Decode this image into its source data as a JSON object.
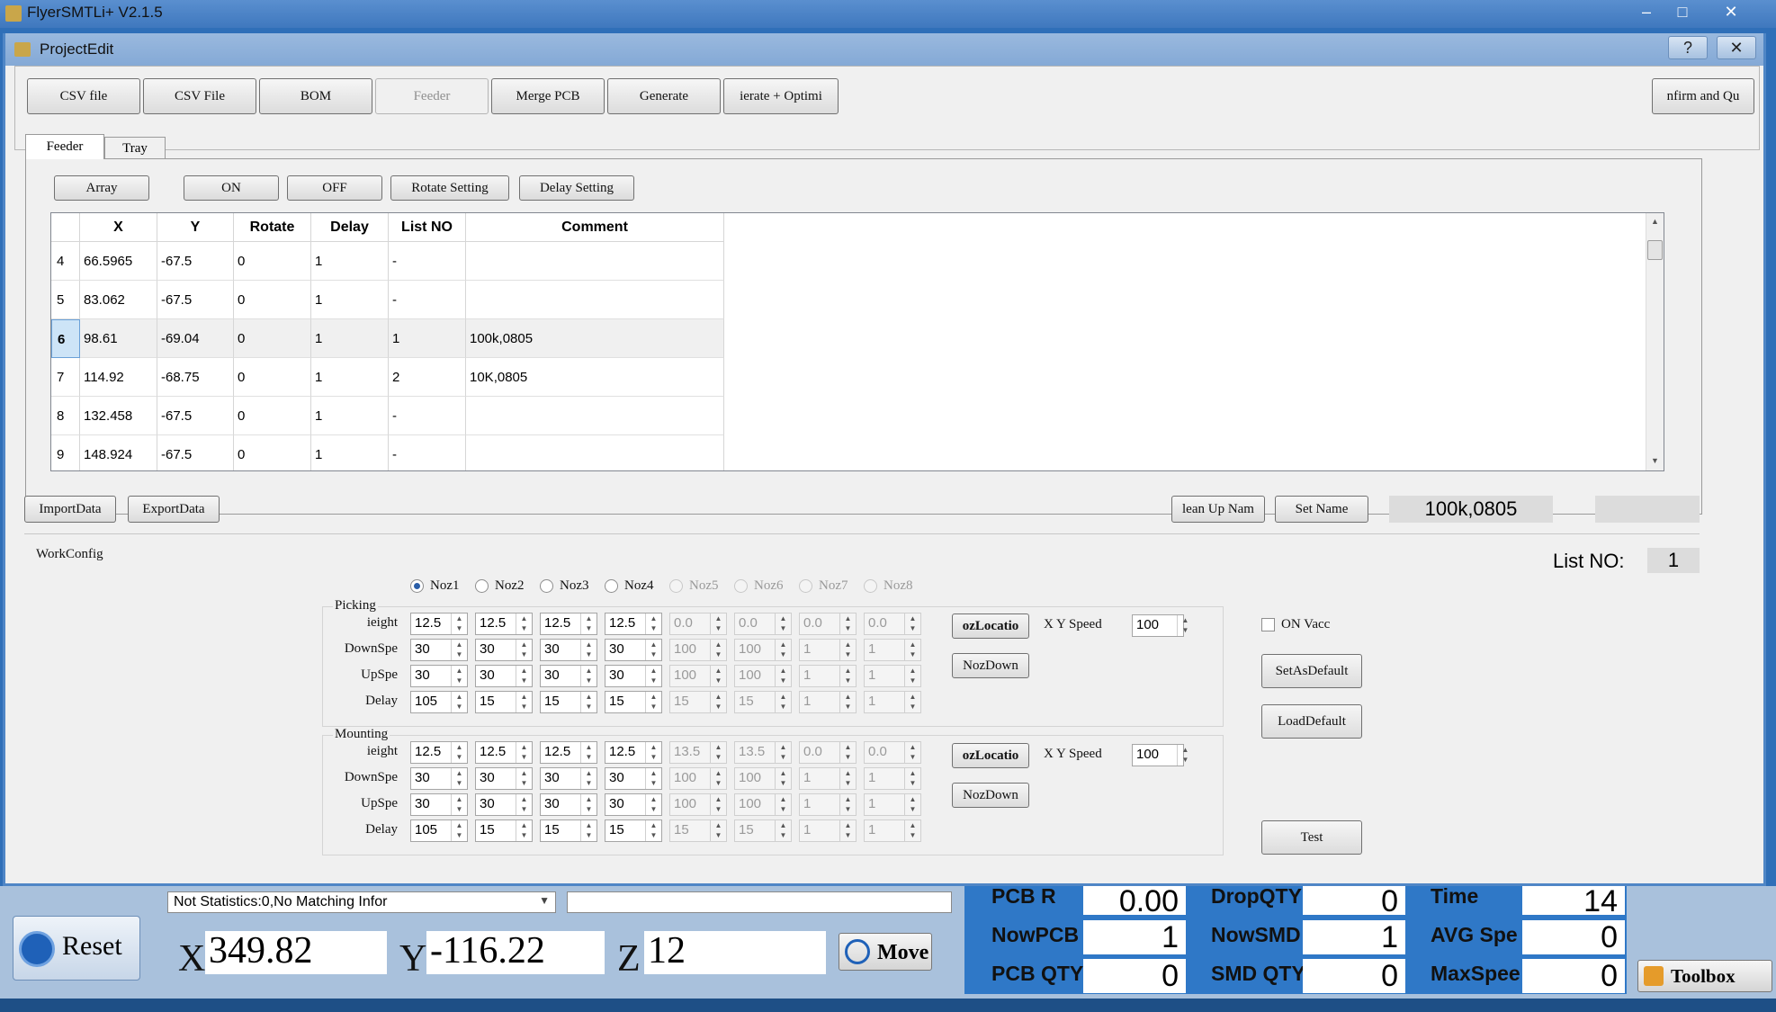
{
  "main_window": {
    "title": "FlyerSMTLi+ V2.1.5"
  },
  "dialog": {
    "title": "ProjectEdit",
    "help": "?",
    "close": "✕"
  },
  "toolbar": [
    {
      "label": "CSV file"
    },
    {
      "label": "CSV File"
    },
    {
      "label": "BOM"
    },
    {
      "label": "Feeder"
    },
    {
      "label": "Merge PCB"
    },
    {
      "label": "Generate"
    },
    {
      "label": "ierate + Optimi"
    }
  ],
  "confirm_button": "nfirm and Qu",
  "tabs": [
    "Feeder",
    "Tray"
  ],
  "feeder_buttons": {
    "array": "Array",
    "on": "ON",
    "off": "OFF",
    "rotate": "Rotate Setting",
    "delay": "Delay Setting"
  },
  "grid": {
    "columns": [
      "X",
      "Y",
      "Rotate",
      "Delay",
      "List NO",
      "Comment"
    ],
    "rows": [
      {
        "n": "4",
        "x": "66.5965",
        "y": "-67.5",
        "rotate": "0",
        "delay": "1",
        "list_no": "-",
        "comment": ""
      },
      {
        "n": "5",
        "x": "83.062",
        "y": "-67.5",
        "rotate": "0",
        "delay": "1",
        "list_no": "-",
        "comment": ""
      },
      {
        "n": "6",
        "x": "98.61",
        "y": "-69.04",
        "rotate": "0",
        "delay": "1",
        "list_no": "1",
        "comment": "100k,0805"
      },
      {
        "n": "7",
        "x": "114.92",
        "y": "-68.75",
        "rotate": "0",
        "delay": "1",
        "list_no": "2",
        "comment": "10K,0805"
      },
      {
        "n": "8",
        "x": "132.458",
        "y": "-67.5",
        "rotate": "0",
        "delay": "1",
        "list_no": "-",
        "comment": ""
      },
      {
        "n": "9",
        "x": "148.924",
        "y": "-67.5",
        "rotate": "0",
        "delay": "1",
        "list_no": "-",
        "comment": ""
      }
    ]
  },
  "data_buttons": {
    "import": "ImportData",
    "export": "ExportData",
    "cleanup": "lean Up Nam",
    "set_name": "Set Name"
  },
  "name_display": "100k,0805",
  "workconfig": {
    "title": "WorkConfig",
    "list_no_label": "List NO:",
    "list_no_value": "1",
    "nozzles": [
      "Noz1",
      "Noz2",
      "Noz3",
      "Noz4",
      "Noz5",
      "Noz6",
      "Noz7",
      "Noz8"
    ],
    "picking": {
      "title": "Picking",
      "labels": [
        "ieight",
        "DownSpe",
        "UpSpe",
        "Delay"
      ],
      "values": [
        [
          "12.5",
          "12.5",
          "12.5",
          "12.5",
          "0.0",
          "0.0",
          "0.0",
          "0.0"
        ],
        [
          "30",
          "30",
          "30",
          "30",
          "100",
          "100",
          "1",
          "1"
        ],
        [
          "30",
          "30",
          "30",
          "30",
          "100",
          "100",
          "1",
          "1"
        ],
        [
          "105",
          "15",
          "15",
          "15",
          "15",
          "15",
          "1",
          "1"
        ]
      ]
    },
    "mounting": {
      "title": "Mounting",
      "labels": [
        "ieight",
        "DownSpe",
        "UpSpe",
        "Delay"
      ],
      "values": [
        [
          "12.5",
          "12.5",
          "12.5",
          "12.5",
          "13.5",
          "13.5",
          "0.0",
          "0.0"
        ],
        [
          "30",
          "30",
          "30",
          "30",
          "100",
          "100",
          "1",
          "1"
        ],
        [
          "30",
          "30",
          "30",
          "30",
          "100",
          "100",
          "1",
          "1"
        ],
        [
          "105",
          "15",
          "15",
          "15",
          "15",
          "15",
          "1",
          "1"
        ]
      ]
    },
    "noz_location": "ozLocatio",
    "noz_down": "NozDown",
    "xy_speed_label": "X Y Speed",
    "xy_speed_pick": "100",
    "xy_speed_mount": "100",
    "on_vacc": "ON Vacc",
    "set_default": "SetAsDefault",
    "load_default": "LoadDefault",
    "test": "Test"
  },
  "bottom": {
    "status_select": "Not Statistics:0,No Matching Infor",
    "reset": "Reset",
    "x_label": "X",
    "x_value": "349.82",
    "y_label": "Y",
    "y_value": "-116.22",
    "z_label": "Z",
    "z_value": "12",
    "move": "Move",
    "stats": [
      {
        "label": "PCB R",
        "value": "0.00"
      },
      {
        "label": "DropQTY",
        "value": "0"
      },
      {
        "label": "Time",
        "value": "14"
      },
      {
        "label": "NowPCB",
        "value": "1"
      },
      {
        "label": "NowSMD",
        "value": "1"
      },
      {
        "label": "AVG Spe",
        "value": "0"
      },
      {
        "label": "PCB QTY",
        "value": "0"
      },
      {
        "label": "SMD QTY",
        "value": "0"
      },
      {
        "label": "MaxSpee",
        "value": "0"
      }
    ],
    "toolbox": "Toolbox"
  }
}
